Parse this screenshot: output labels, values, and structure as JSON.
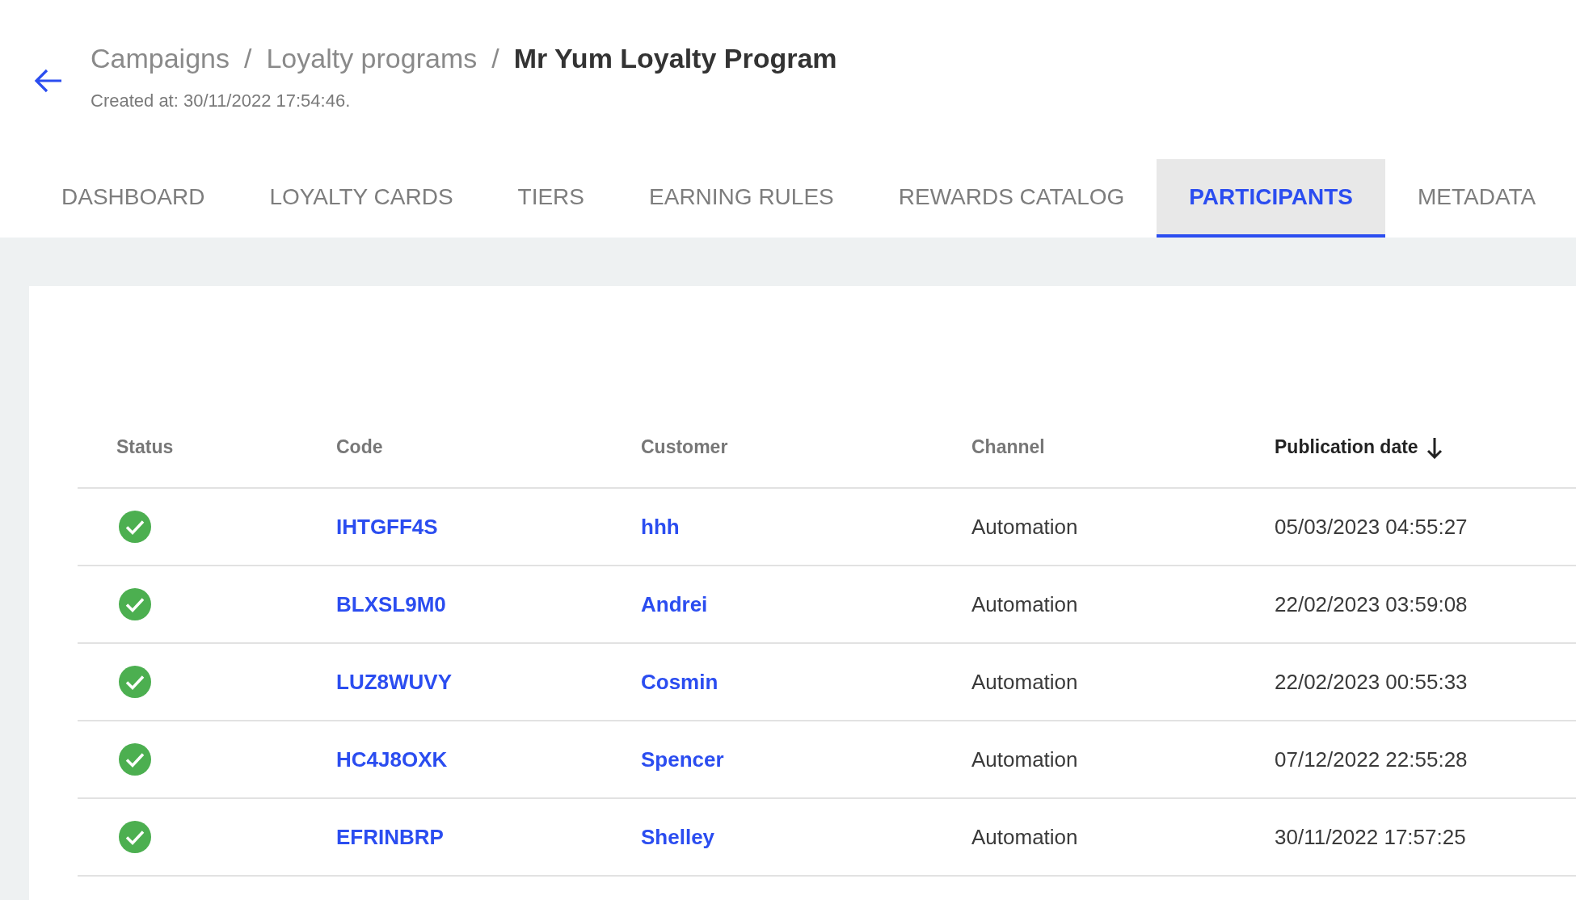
{
  "breadcrumb": [
    {
      "label": "Campaigns",
      "current": false
    },
    {
      "label": "Loyalty programs",
      "current": false
    },
    {
      "label": "Mr Yum Loyalty Program",
      "current": true
    }
  ],
  "breadcrumb_separator": "/",
  "created_at": "Created at: 30/11/2022 17:54:46.",
  "tabs": [
    {
      "label": "DASHBOARD",
      "selected": false
    },
    {
      "label": "LOYALTY CARDS",
      "selected": false
    },
    {
      "label": "TIERS",
      "selected": false
    },
    {
      "label": "EARNING RULES",
      "selected": false
    },
    {
      "label": "REWARDS CATALOG",
      "selected": false
    },
    {
      "label": "PARTICIPANTS",
      "selected": true
    },
    {
      "label": "METADATA",
      "selected": false
    }
  ],
  "table": {
    "columns": [
      {
        "label": "Status",
        "sorted_descending": false
      },
      {
        "label": "Code",
        "sorted_descending": false
      },
      {
        "label": "Customer",
        "sorted_descending": false
      },
      {
        "label": "Channel",
        "sorted_descending": false
      },
      {
        "label": "Publication date",
        "sorted_descending": true
      }
    ],
    "rows": [
      {
        "active": true,
        "code": "IHTGFF4S",
        "customer": "hhh",
        "channel": "Automation",
        "publication_date": "05/03/2023 04:55:27"
      },
      {
        "active": true,
        "code": "BLXSL9M0",
        "customer": "Andrei",
        "channel": "Automation",
        "publication_date": "22/02/2023 03:59:08"
      },
      {
        "active": true,
        "code": "LUZ8WUVY",
        "customer": "Cosmin",
        "channel": "Automation",
        "publication_date": "22/02/2023 00:55:33"
      },
      {
        "active": true,
        "code": "HC4J8OXK",
        "customer": "Spencer",
        "channel": "Automation",
        "publication_date": "07/12/2022 22:55:28"
      },
      {
        "active": true,
        "code": "EFRINBRP",
        "customer": "Shelley",
        "channel": "Automation",
        "publication_date": "30/11/2022 17:57:25"
      }
    ]
  }
}
